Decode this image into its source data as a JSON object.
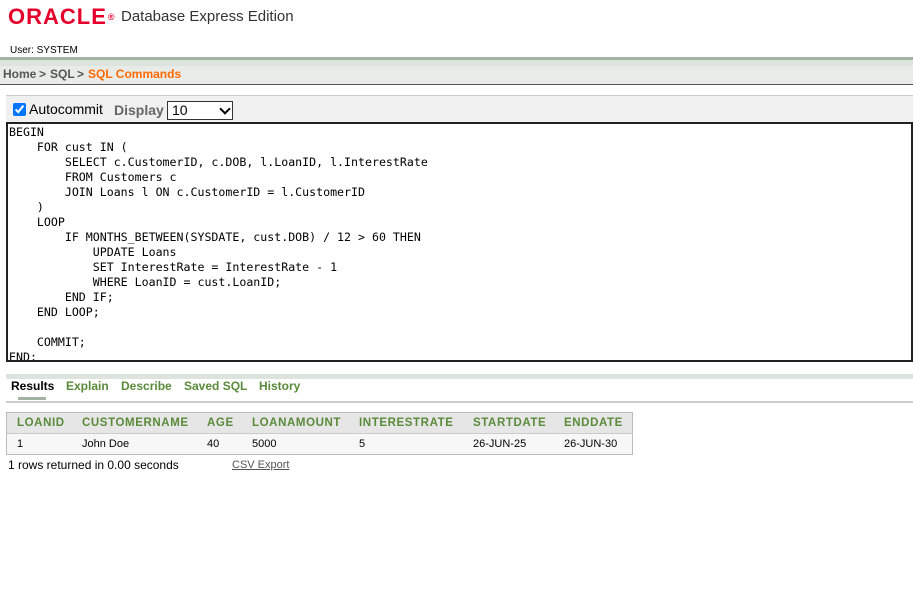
{
  "header": {
    "logo": "ORACLE",
    "logo_mark": "®",
    "product": "Database Express Edition",
    "user": "User: SYSTEM"
  },
  "breadcrumb": {
    "home": "Home",
    "sep1": ">",
    "sql": "SQL",
    "sep2": ">",
    "current": "SQL Commands"
  },
  "toolbar": {
    "autocommit_label": "Autocommit",
    "autocommit_checked": true,
    "display_label": "Display",
    "display_value": "10"
  },
  "editor": {
    "lines": [
      "BEGIN",
      "    FOR cust IN (",
      "        SELECT c.CustomerID, c.DOB, l.LoanID, l.InterestRate",
      "        FROM Customers c",
      "        JOIN Loans l ON c.CustomerID = l.CustomerID",
      "    )",
      "    LOOP",
      "        IF MONTHS_BETWEEN(SYSDATE, cust.DOB) / 12 > 60 THEN",
      "            UPDATE Loans",
      "            SET InterestRate = InterestRate - 1",
      "            WHERE LoanID = cust.LoanID;",
      "        END IF;",
      "    END LOOP;",
      "",
      "    COMMIT;",
      "END;"
    ]
  },
  "tabs": [
    "Results",
    "Explain",
    "Describe",
    "Saved SQL",
    "History"
  ],
  "active_tab": "Results",
  "results": {
    "columns": [
      "LOANID",
      "CUSTOMERNAME",
      "AGE",
      "LOANAMOUNT",
      "INTERESTRATE",
      "STARTDATE",
      "ENDDATE"
    ],
    "rows": [
      [
        "1",
        "John Doe",
        "40",
        "5000",
        "5",
        "26-JUN-25",
        "26-JUN-30"
      ]
    ]
  },
  "footer": {
    "rows_info": "1 rows returned in 0.00 seconds",
    "csv_export": "CSV Export"
  },
  "colors": {
    "brand": "#e4002b",
    "breadcrumb_current": "#ff6a00",
    "tab_green": "#5a8a3a"
  }
}
